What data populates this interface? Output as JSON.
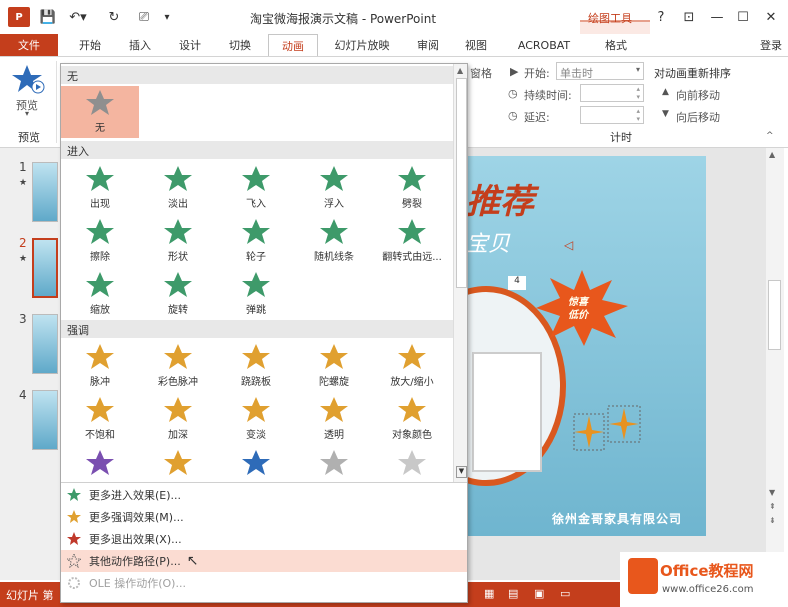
{
  "window": {
    "title": "淘宝微海报演示文稿 - PowerPoint",
    "context_tool": "绘图工具",
    "help": "?",
    "login": "登录"
  },
  "tabs": [
    "文件",
    "开始",
    "插入",
    "设计",
    "切换",
    "动画",
    "幻灯片放映",
    "审阅",
    "视图",
    "ACROBAT",
    "格式"
  ],
  "ribbon": {
    "preview_label": "预览",
    "preview_group": "预览",
    "partial_label": "窗格",
    "start_label": "开始:",
    "start_value": "单击时",
    "duration_label": "持续时间:",
    "delay_label": "延迟:",
    "reorder_title": "对动画重新排序",
    "move_earlier": "向前移动",
    "move_later": "向后移动",
    "timing_group": "计时"
  },
  "thumbnails": [
    "1",
    "2",
    "3",
    "4"
  ],
  "slide": {
    "headline": "推荐",
    "subtitle": "宝贝",
    "badge": "4",
    "burst_line1": "惊喜",
    "burst_line2": "低价",
    "company": "徐州金哥家具有限公司"
  },
  "status": {
    "left": "幻灯片 第"
  },
  "dropdown": {
    "section_none": "无",
    "none_label": "无",
    "section_entrance": "进入",
    "entrance": [
      "出现",
      "淡出",
      "飞入",
      "浮入",
      "劈裂",
      "擦除",
      "形状",
      "轮子",
      "随机线条",
      "翻转式由远...",
      "缩放",
      "旋转",
      "弹跳"
    ],
    "section_emphasis": "强调",
    "emphasis": [
      "脉冲",
      "彩色脉冲",
      "跷跷板",
      "陀螺旋",
      "放大/缩小",
      "不饱和",
      "加深",
      "变淡",
      "透明",
      "对象颜色"
    ],
    "menu": [
      "更多进入效果(E)...",
      "更多强调效果(M)...",
      "更多退出效果(X)...",
      "其他动作路径(P)...",
      "OLE 操作动作(O)..."
    ]
  },
  "watermark": {
    "brand": "Office教程网",
    "url": "www.office26.com"
  },
  "colors": {
    "accent": "#c43e1c",
    "entrance_star": "#3e9a6a",
    "emphasis_star": "#e0a030",
    "exit_star": "#c0392b",
    "selected_bg": "#f4b5a0"
  }
}
